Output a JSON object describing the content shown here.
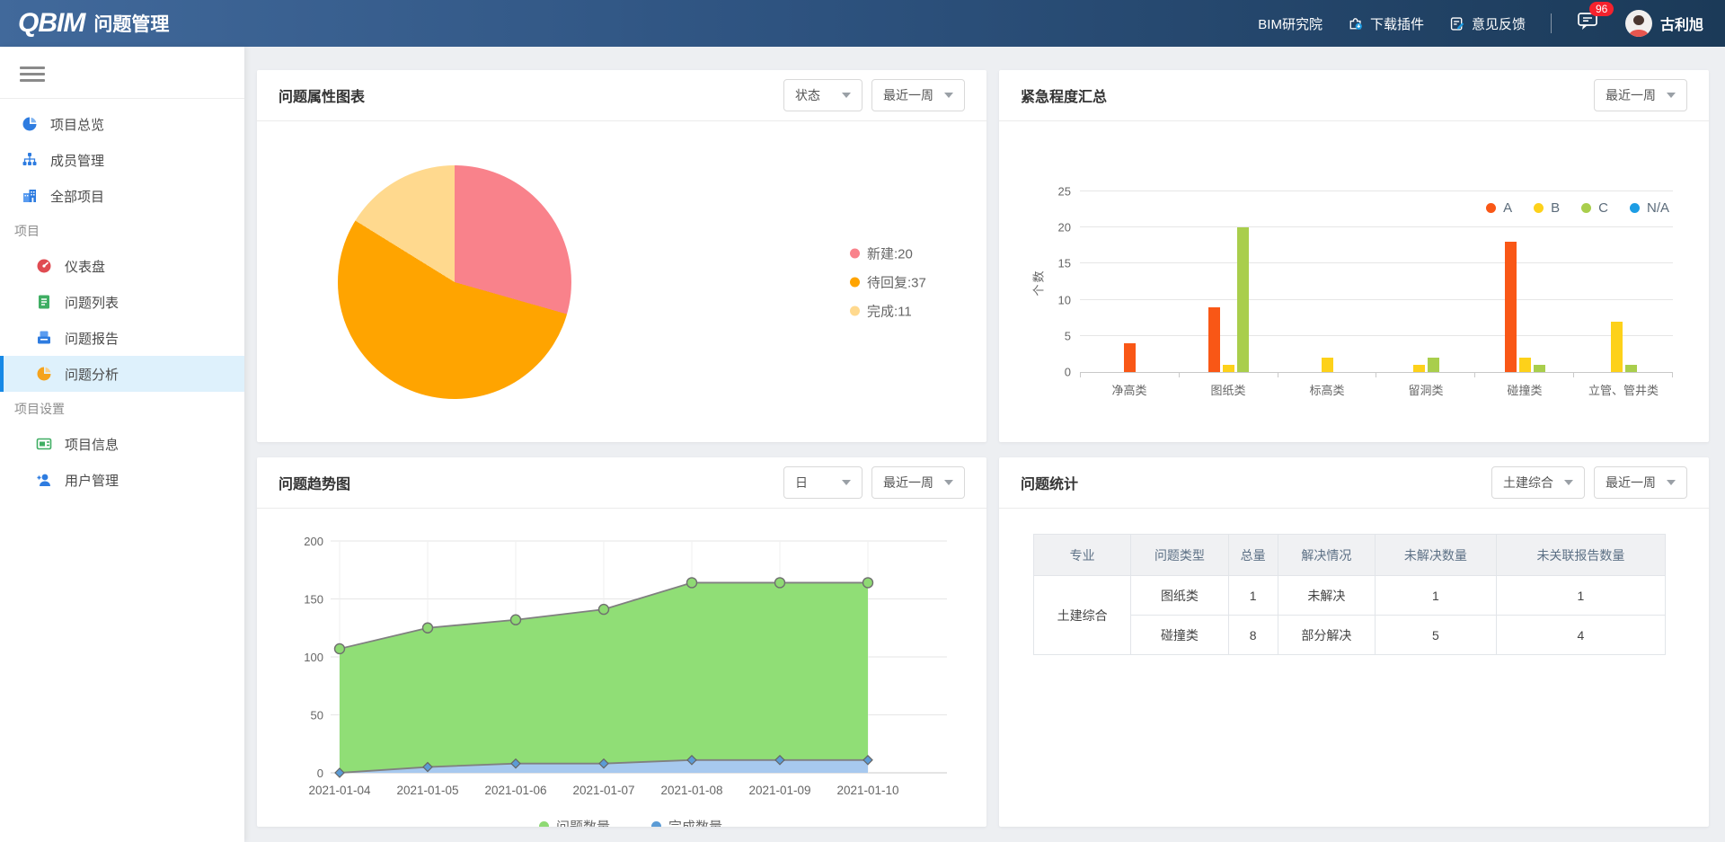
{
  "header": {
    "logo_mark": "Q",
    "logo_text": "BIM",
    "app_title": "问题管理",
    "nav": [
      {
        "label": "BIM研究院",
        "icon": null
      },
      {
        "label": "下载插件",
        "icon": "plugin-download-icon"
      },
      {
        "label": "意见反馈",
        "icon": "feedback-icon"
      }
    ],
    "messages_badge": "96",
    "user_name": "古利旭"
  },
  "sidebar": {
    "items": [
      {
        "label": "项目总览",
        "icon": "overview-pie-icon",
        "type": "item",
        "indent": false,
        "active": false
      },
      {
        "label": "成员管理",
        "icon": "members-icon",
        "type": "item",
        "indent": false,
        "active": false
      },
      {
        "label": "全部项目",
        "icon": "projects-building-icon",
        "type": "item",
        "indent": false,
        "active": false
      },
      {
        "label": "项目",
        "type": "section"
      },
      {
        "label": "仪表盘",
        "icon": "dashboard-gauge-icon",
        "type": "item",
        "indent": true,
        "active": false
      },
      {
        "label": "问题列表",
        "icon": "issue-list-icon",
        "type": "item",
        "indent": true,
        "active": false
      },
      {
        "label": "问题报告",
        "icon": "issue-report-icon",
        "type": "item",
        "indent": true,
        "active": false
      },
      {
        "label": "问题分析",
        "icon": "issue-analysis-icon",
        "type": "item",
        "indent": true,
        "active": true
      },
      {
        "label": "项目设置",
        "type": "section"
      },
      {
        "label": "项目信息",
        "icon": "project-info-icon",
        "type": "item",
        "indent": true,
        "active": false
      },
      {
        "label": "用户管理",
        "icon": "user-management-icon",
        "type": "item",
        "indent": true,
        "active": false
      }
    ]
  },
  "panels": {
    "pie_panel": {
      "title": "问题属性图表",
      "filters": [
        "状态",
        "最近一周"
      ]
    },
    "bar_panel": {
      "title": "紧急程度汇总",
      "filters": [
        "最近一周"
      ]
    },
    "trend_panel": {
      "title": "问题趋势图",
      "filters": [
        "日",
        "最近一周"
      ]
    },
    "stats_panel": {
      "title": "问题统计",
      "filters": [
        "土建综合",
        "最近一周"
      ]
    }
  },
  "chart_data": [
    {
      "type": "pie",
      "title": "问题属性图表",
      "slices": [
        {
          "label": "新建",
          "value": 20,
          "color": "#F9828B"
        },
        {
          "label": "待回复",
          "value": 37,
          "color": "#FFA400"
        },
        {
          "label": "完成",
          "value": 11,
          "color": "#FFD98E"
        }
      ],
      "legend_position": "right",
      "legend_format": "label:value"
    },
    {
      "type": "bar",
      "title": "紧急程度汇总",
      "ylabel": "个数",
      "ylim": [
        0,
        25
      ],
      "yticks": [
        0,
        5,
        10,
        15,
        20,
        25
      ],
      "categories": [
        "净高类",
        "图纸类",
        "标高类",
        "留洞类",
        "碰撞类",
        "立管、管井类"
      ],
      "series": [
        {
          "name": "A",
          "color": "#F95716",
          "values": [
            4,
            9,
            0,
            0,
            18,
            0
          ]
        },
        {
          "name": "B",
          "color": "#FDD11A",
          "values": [
            0,
            1,
            2,
            1,
            2,
            7
          ]
        },
        {
          "name": "C",
          "color": "#A9CE4C",
          "values": [
            0,
            20,
            0,
            2,
            1,
            1
          ]
        },
        {
          "name": "N/A",
          "color": "#1D9DE4",
          "values": [
            0,
            0,
            0,
            0,
            0,
            0
          ]
        }
      ],
      "legend_position": "top-right",
      "grid": true
    },
    {
      "type": "area",
      "title": "问题趋势图",
      "x": [
        "2021-01-04",
        "2021-01-05",
        "2021-01-06",
        "2021-01-07",
        "2021-01-08",
        "2021-01-09",
        "2021-01-10"
      ],
      "ylim": [
        0,
        200
      ],
      "yticks": [
        0,
        50,
        100,
        150,
        200
      ],
      "series": [
        {
          "name": "问题数量",
          "fill": "#90DE76",
          "line": "#808080",
          "marker": "circle",
          "marker_color": "#8ED973",
          "values": [
            107,
            125,
            132,
            141,
            164,
            164,
            164
          ]
        },
        {
          "name": "完成数量",
          "fill": "#A7C9EF",
          "line": "#808080",
          "marker": "diamond",
          "marker_color": "#5B9BD5",
          "values": [
            0,
            5,
            8,
            8,
            11,
            11,
            11
          ]
        }
      ],
      "legend_position": "bottom",
      "grid": true
    },
    {
      "type": "table",
      "title": "问题统计",
      "columns": [
        "专业",
        "问题类型",
        "总量",
        "解决情况",
        "未解决数量",
        "未关联报告数量"
      ],
      "rows": [
        [
          "土建综合",
          "图纸类",
          "1",
          "未解决",
          "1",
          "1"
        ],
        [
          "",
          "碰撞类",
          "8",
          "部分解决",
          "5",
          "4"
        ]
      ],
      "merged_first_column": true
    }
  ]
}
